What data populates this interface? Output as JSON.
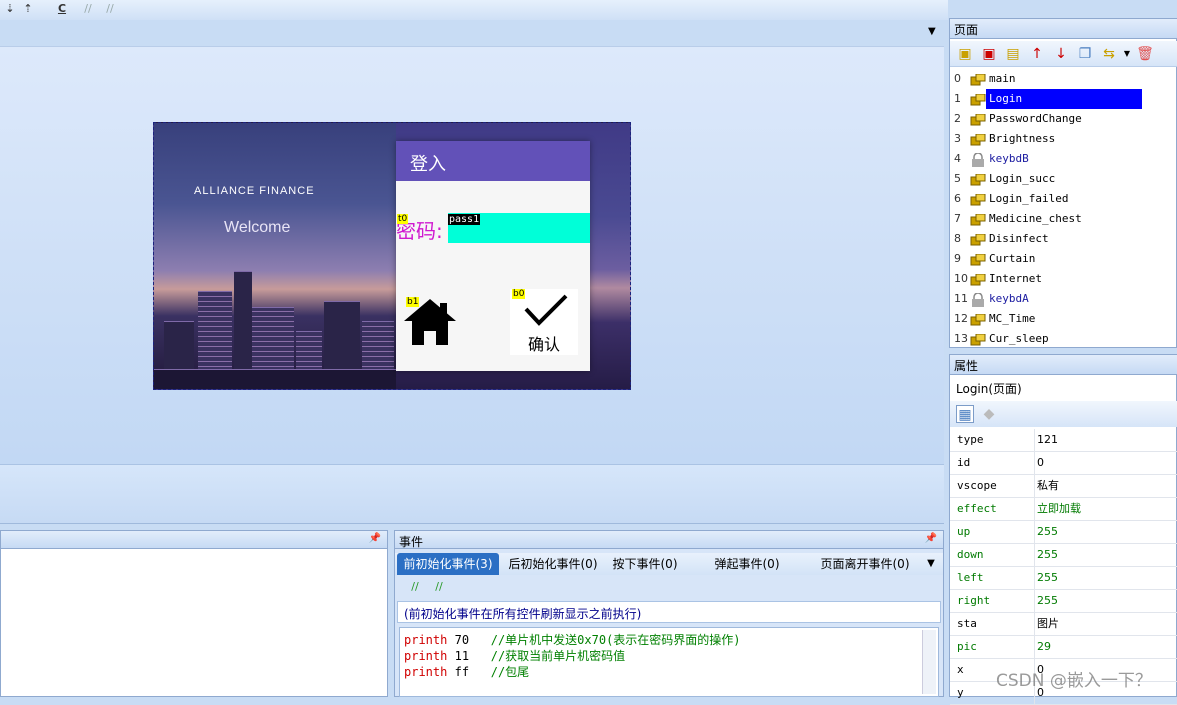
{
  "toolbar": {
    "items": [
      "C"
    ]
  },
  "hmi": {
    "brand": "ALLIANCE FINANCE",
    "welcome": "Welcome",
    "login_title": "登入",
    "password_label": "密码:",
    "password_value": "pass1",
    "tags": {
      "t0": "t0",
      "b1": "b1",
      "b0": "b0"
    },
    "confirm_label": "确认"
  },
  "bottom_left_panel": {
    "title": ""
  },
  "events_panel": {
    "title": "事件",
    "tabs": [
      {
        "label": "前初始化事件(3)",
        "active": true
      },
      {
        "label": "后初始化事件(0)",
        "active": false
      },
      {
        "label": "按下事件(0)",
        "active": false
      },
      {
        "label": "弹起事件(0)",
        "active": false
      },
      {
        "label": "页面离开事件(0)",
        "active": false
      }
    ],
    "hint": "(前初始化事件在所有控件刷新显示之前执行)",
    "code": [
      {
        "cmd": "printh",
        "arg": "70",
        "comment": "//单片机中发送0x70(表示在密码界面的操作)"
      },
      {
        "cmd": "printh",
        "arg": "11",
        "comment": "//获取当前单片机密码值"
      },
      {
        "cmd": "printh",
        "arg": "ff",
        "comment": "//包尾"
      }
    ]
  },
  "pages_panel": {
    "title": "页面",
    "pages": [
      {
        "num": "0",
        "name": "main",
        "locked": false,
        "selected": false
      },
      {
        "num": "1",
        "name": "Login",
        "locked": false,
        "selected": true
      },
      {
        "num": "2",
        "name": "PasswordChange",
        "locked": false,
        "selected": false
      },
      {
        "num": "3",
        "name": "Brightness",
        "locked": false,
        "selected": false
      },
      {
        "num": "4",
        "name": "keybdB",
        "locked": true,
        "selected": false
      },
      {
        "num": "5",
        "name": "Login_succ",
        "locked": false,
        "selected": false
      },
      {
        "num": "6",
        "name": "Login_failed",
        "locked": false,
        "selected": false
      },
      {
        "num": "7",
        "name": "Medicine_chest",
        "locked": false,
        "selected": false
      },
      {
        "num": "8",
        "name": "Disinfect",
        "locked": false,
        "selected": false
      },
      {
        "num": "9",
        "name": "Curtain",
        "locked": false,
        "selected": false
      },
      {
        "num": "10",
        "name": "Internet",
        "locked": false,
        "selected": false
      },
      {
        "num": "11",
        "name": "keybdA",
        "locked": true,
        "selected": false
      },
      {
        "num": "12",
        "name": "MC_Time",
        "locked": false,
        "selected": false
      },
      {
        "num": "13",
        "name": "Cur_sleep",
        "locked": false,
        "selected": false
      }
    ]
  },
  "props_panel": {
    "title": "属性",
    "subtitle": "Login(页面)",
    "rows": [
      {
        "key": "type",
        "val": "121",
        "green": false
      },
      {
        "key": "id",
        "val": "0",
        "green": false
      },
      {
        "key": "vscope",
        "val": "私有",
        "green": false
      },
      {
        "key": "effect",
        "val": "立即加载",
        "green": true
      },
      {
        "key": "up",
        "val": "255",
        "green": true
      },
      {
        "key": "down",
        "val": "255",
        "green": true
      },
      {
        "key": "left",
        "val": "255",
        "green": true
      },
      {
        "key": "right",
        "val": "255",
        "green": true
      },
      {
        "key": "sta",
        "val": "图片",
        "green": false
      },
      {
        "key": "pic",
        "val": "29",
        "green": true
      },
      {
        "key": "x",
        "val": "0",
        "green": false
      },
      {
        "key": "y",
        "val": "0",
        "green": false
      }
    ]
  },
  "watermark": "CSDN @嵌入一下？"
}
